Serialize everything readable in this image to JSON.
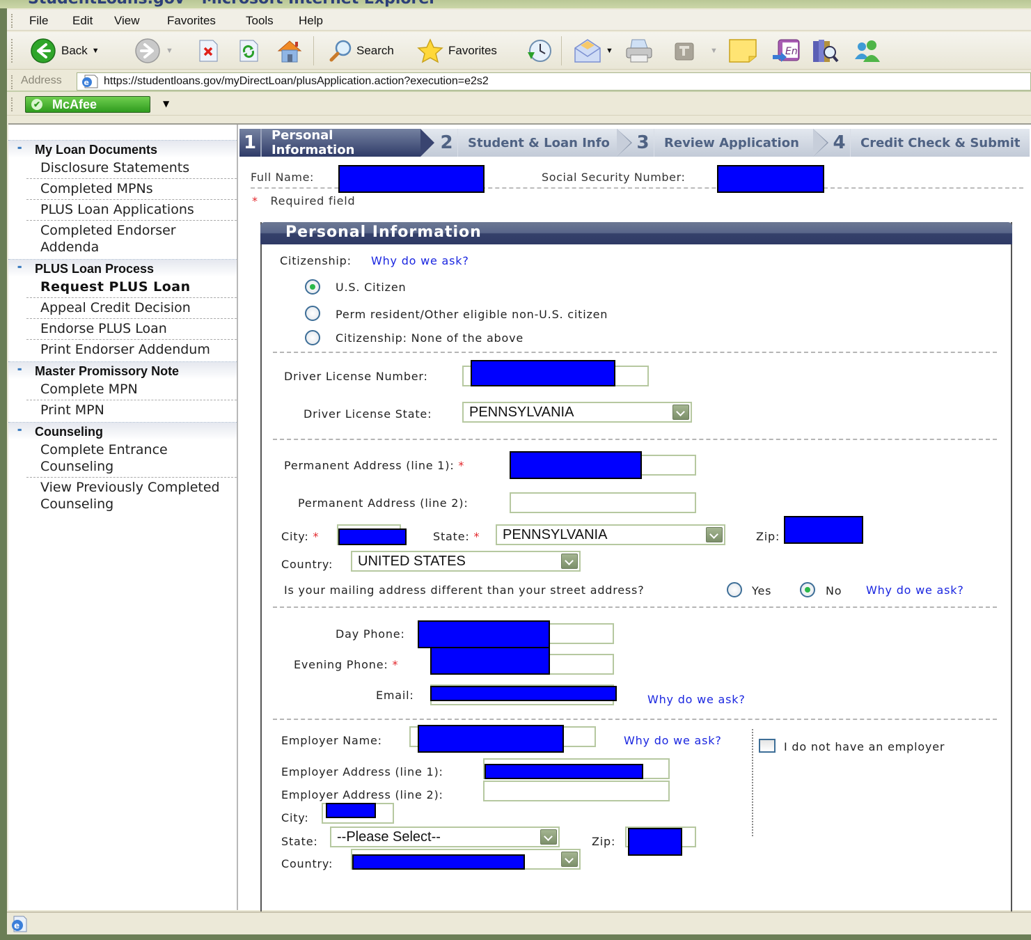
{
  "window": {
    "title": "StudentLoans.gov - Microsoft Internet Explorer"
  },
  "menu": [
    "File",
    "Edit",
    "View",
    "Favorites",
    "Tools",
    "Help"
  ],
  "toolbar": {
    "back_label": "Back",
    "search_label": "Search",
    "favorites_label": "Favorites"
  },
  "address": {
    "label": "Address",
    "url": "https://studentloans.gov/myDirectLoan/plusApplication.action?execution=e2s2"
  },
  "mcafee": {
    "label": "McAfee"
  },
  "sidebar": {
    "sections": [
      {
        "title": "My Loan Documents",
        "items": [
          "Disclosure Statements",
          "Completed MPNs",
          "PLUS Loan Applications",
          "Completed Endorser Addenda"
        ]
      },
      {
        "title": "PLUS Loan Process",
        "items": [
          "Request PLUS Loan",
          "Appeal Credit Decision",
          "Endorse PLUS Loan",
          "Print Endorser Addendum"
        ],
        "active": "Request PLUS Loan"
      },
      {
        "title": "Master Promissory Note",
        "items": [
          "Complete MPN",
          "Print MPN"
        ]
      },
      {
        "title": "Counseling",
        "items": [
          "Complete Entrance Counseling",
          "View Previously Completed Counseling"
        ]
      }
    ]
  },
  "steps": [
    {
      "num": "1",
      "label": "Personal Information",
      "active": true
    },
    {
      "num": "2",
      "label": "Student & Loan Info",
      "active": false
    },
    {
      "num": "3",
      "label": "Review Application",
      "active": false
    },
    {
      "num": "4",
      "label": "Credit Check & Submit",
      "active": false
    }
  ],
  "header": {
    "full_name_label": "Full Name:",
    "ssn_label": "Social Security Number:",
    "required_note": "Required field",
    "required_mark": "*"
  },
  "panel": {
    "title": "Personal Information",
    "citizenship": {
      "label": "Citizenship:",
      "why_link": "Why do we ask?",
      "options": [
        "U.S. Citizen",
        "Perm resident/Other eligible non-U.S. citizen",
        "Citizenship: None of the above"
      ],
      "selected": "U.S. Citizen"
    },
    "license": {
      "number_label": "Driver License Number:",
      "state_label": "Driver License State:",
      "state_value": "PENNSYLVANIA"
    },
    "address": {
      "line1_label": "Permanent Address (line 1):",
      "line2_label": "Permanent Address (line 2):",
      "line2_value": "",
      "city_label": "City:",
      "state_label": "State:",
      "state_value": "PENNSYLVANIA",
      "zip_label": "Zip:",
      "country_label": "Country:",
      "country_value": "UNITED STATES",
      "mailing_question": "Is your mailing address different than your street address?",
      "mailing_yes": "Yes",
      "mailing_no": "No",
      "mailing_selected": "No",
      "why_link": "Why do we ask?"
    },
    "contact": {
      "day_phone_label": "Day Phone:",
      "evening_phone_label": "Evening Phone:",
      "email_label": "Email:",
      "why_link": "Why do we ask?"
    },
    "employer": {
      "name_label": "Employer Name:",
      "why_link": "Why do we ask?",
      "no_employer_label": "I do not have an employer",
      "no_employer_checked": false,
      "addr1_label": "Employer Address (line 1):",
      "addr2_label": "Employer Address (line 2):",
      "addr2_value": "",
      "city_label": "City:",
      "state_label": "State:",
      "state_value": "--Please Select--",
      "zip_label": "Zip:",
      "country_label": "Country:"
    }
  }
}
